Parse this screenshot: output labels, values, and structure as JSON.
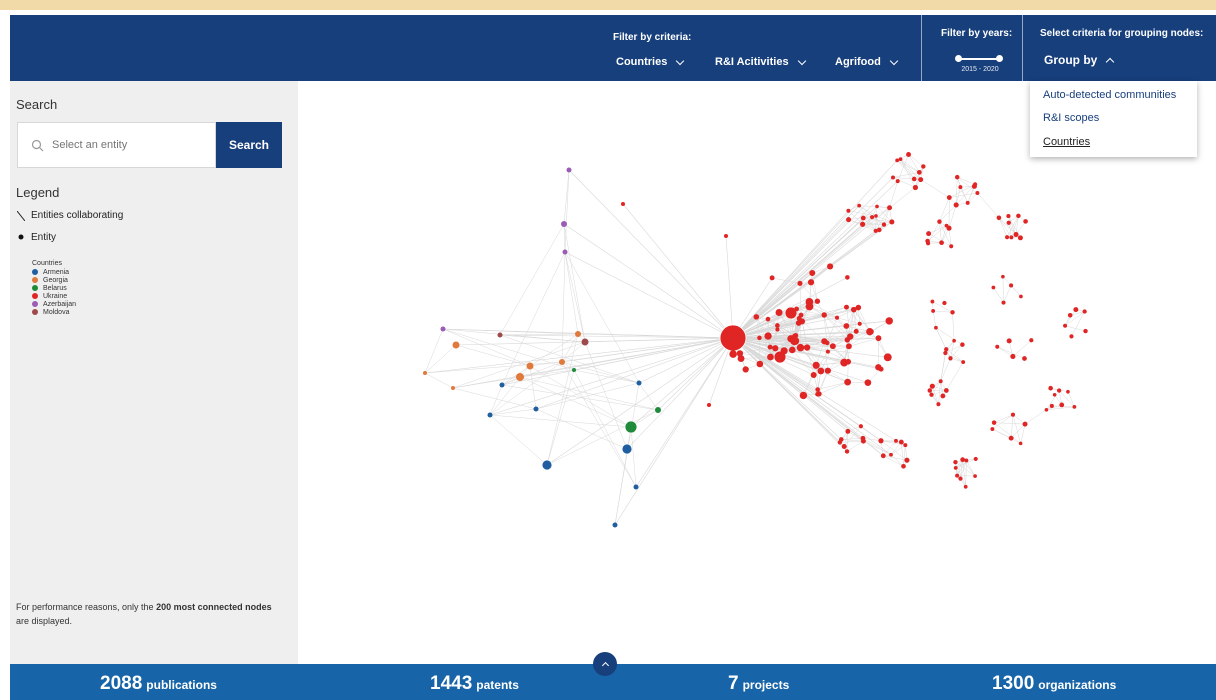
{
  "header": {
    "filter_criteria_title": "Filter by criteria:",
    "criteria": [
      {
        "label": "Countries"
      },
      {
        "label": "R&I Acitivities"
      },
      {
        "label": "Agrifood"
      }
    ],
    "filter_years_title": "Filter by years:",
    "year_range": "2015 - 2020",
    "grouping_title": "Select criteria for grouping nodes:",
    "group_by_label": "Group by"
  },
  "group_by_menu": {
    "options": [
      "Auto-detected communities",
      "R&I scopes",
      "Countries"
    ],
    "selected": "Countries"
  },
  "sidebar": {
    "search_title": "Search",
    "search_placeholder": "Select an entity",
    "search_button": "Search",
    "legend_title": "Legend",
    "legend_edge": "Entities collaborating",
    "legend_node": "Entity",
    "countries_title": "Countries",
    "countries": [
      {
        "name": "Armenia",
        "color": "#1f5fa0"
      },
      {
        "name": "Georgia",
        "color": "#e07a3c"
      },
      {
        "name": "Belarus",
        "color": "#1e8a3a"
      },
      {
        "name": "Ukraine",
        "color": "#e02525"
      },
      {
        "name": "Azerbaijan",
        "color": "#9a5cb4"
      },
      {
        "name": "Moldova",
        "color": "#9e4a4a"
      }
    ],
    "perf_note_pre": "For performance reasons, only the ",
    "perf_note_bold": "200 most connected nodes",
    "perf_note_post": " are displayed."
  },
  "footer": {
    "stats": [
      {
        "value": "2088",
        "label": "publications"
      },
      {
        "value": "1443",
        "label": "patents"
      },
      {
        "value": "7",
        "label": "projects"
      },
      {
        "value": "1300",
        "label": "organizations"
      }
    ]
  },
  "graph": {
    "edge_color": "#d8d8d8",
    "node_border": "#ffffff"
  }
}
